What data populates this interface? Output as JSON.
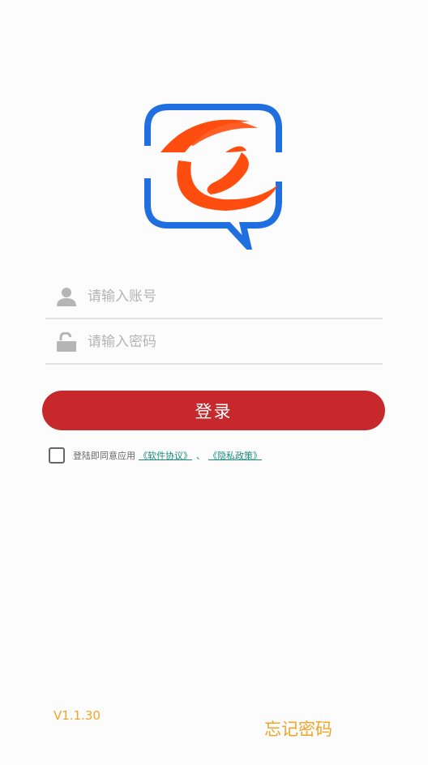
{
  "login": {
    "account_placeholder": "请输入账号",
    "password_placeholder": "请输入密码",
    "submit_label": "登录"
  },
  "agreement": {
    "prefix": "登陆即同意应用",
    "software_link": "《软件协议》",
    "separator": "、",
    "privacy_link": "《隐私政策》"
  },
  "footer": {
    "version": "V1.1.30",
    "forgot_password": "忘记密码"
  },
  "icons": {
    "account": "user-icon",
    "password": "unlock-icon"
  },
  "colors": {
    "primary": "#c6282b",
    "accent": "#f2a42a",
    "link": "#1a8a7d",
    "logo_blue": "#1f6fe0",
    "logo_orange": "#ff4d0f"
  }
}
